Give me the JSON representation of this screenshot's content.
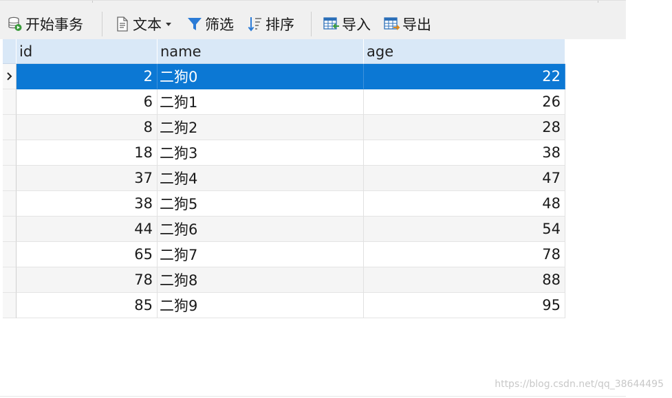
{
  "toolbar": {
    "begin_transaction": {
      "label": "开始事务",
      "icon": "database-transaction-icon"
    },
    "text": {
      "label": "文本",
      "icon": "document-text-icon"
    },
    "filter": {
      "label": "筛选",
      "icon": "filter-funnel-icon"
    },
    "sort": {
      "label": "排序",
      "icon": "sort-icon"
    },
    "import": {
      "label": "导入",
      "icon": "table-import-icon"
    },
    "export": {
      "label": "导出",
      "icon": "table-export-icon"
    }
  },
  "grid": {
    "columns": [
      "id",
      "name",
      "age"
    ],
    "selected_row_index": 0,
    "rows": [
      {
        "id": "2",
        "name": "二狗0",
        "age": "22"
      },
      {
        "id": "6",
        "name": "二狗1",
        "age": "26"
      },
      {
        "id": "8",
        "name": "二狗2",
        "age": "28"
      },
      {
        "id": "18",
        "name": "二狗3",
        "age": "38"
      },
      {
        "id": "37",
        "name": "二狗4",
        "age": "47"
      },
      {
        "id": "38",
        "name": "二狗5",
        "age": "48"
      },
      {
        "id": "44",
        "name": "二狗6",
        "age": "54"
      },
      {
        "id": "65",
        "name": "二狗7",
        "age": "78"
      },
      {
        "id": "78",
        "name": "二狗8",
        "age": "88"
      },
      {
        "id": "85",
        "name": "二狗9",
        "age": "95"
      }
    ]
  },
  "colors": {
    "selection": "#0c78d4",
    "header": "#d9e8f7",
    "icon_blue": "#2b7bd6",
    "icon_green": "#3a9a3a"
  },
  "watermark": "https://blog.csdn.net/qq_38644495"
}
